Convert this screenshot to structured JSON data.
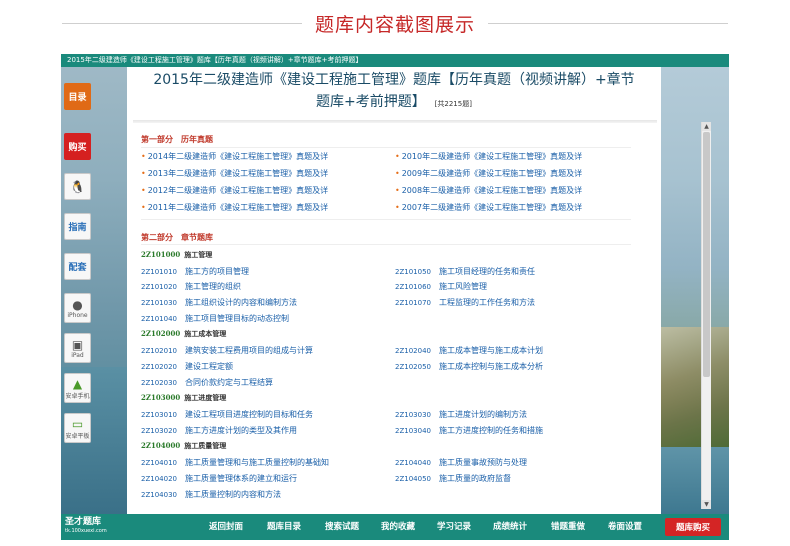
{
  "heading": "题库内容截图展示",
  "window_title": "2015年二级建造师《建设工程施工管理》题库【历年真题（视频讲解）+章节题库+考前押题】",
  "book_title_line1": "2015年二级建造师《建设工程施工管理》题库【历年真题（视频讲解）+章节",
  "book_title_line2": "题库+考前押题】",
  "question_count": "[共2215题]",
  "sidebar": {
    "catalog": "目录",
    "buy": "购买",
    "guide": "指南",
    "config": "配套",
    "iphone": "iPhone",
    "ipad": "iPad",
    "android_phone": "安卓手机",
    "android_tablet": "安卓平板"
  },
  "part1": {
    "title": "第一部分　历年真题",
    "left": [
      "2014年二级建造师《建设工程施工管理》真题及详",
      "2013年二级建造师《建设工程施工管理》真题及详",
      "2012年二级建造师《建设工程施工管理》真题及详",
      "2011年二级建造师《建设工程施工管理》真题及详"
    ],
    "right": [
      "2010年二级建造师《建设工程施工管理》真题及详",
      "2009年二级建造师《建设工程施工管理》真题及详",
      "2008年二级建造师《建设工程施工管理》真题及详",
      "2007年二级建造师《建设工程施工管理》真题及详"
    ]
  },
  "part2": {
    "title": "第二部分　章节题库",
    "chapters": [
      {
        "code": "2Z101000",
        "name": "施工管理"
      },
      {
        "code": "2Z102000",
        "name": "施工成本管理"
      },
      {
        "code": "2Z103000",
        "name": "施工进度管理"
      },
      {
        "code": "2Z104000",
        "name": "施工质量管理"
      }
    ],
    "sections": [
      {
        "code": "2Z101010",
        "name": "施工方的项目管理"
      },
      {
        "code": "2Z101020",
        "name": "施工管理的组织"
      },
      {
        "code": "2Z101030",
        "name": "施工组织设计的内容和编制方法"
      },
      {
        "code": "2Z101040",
        "name": "施工项目管理目标的动态控制"
      },
      {
        "code": "2Z101050",
        "name": "施工项目经理的任务和责任"
      },
      {
        "code": "2Z101060",
        "name": "施工风险管理"
      },
      {
        "code": "2Z101070",
        "name": "工程监理的工作任务和方法"
      },
      {
        "code": "2Z102010",
        "name": "建筑安装工程费用项目的组成与计算"
      },
      {
        "code": "2Z102020",
        "name": "建设工程定额"
      },
      {
        "code": "2Z102030",
        "name": "合同价款约定与工程结算"
      },
      {
        "code": "2Z102040",
        "name": "施工成本管理与施工成本计划"
      },
      {
        "code": "2Z102050",
        "name": "施工成本控制与施工成本分析"
      },
      {
        "code": "2Z103010",
        "name": "建设工程项目进度控制的目标和任务"
      },
      {
        "code": "2Z103020",
        "name": "施工方进度计划的类型及其作用"
      },
      {
        "code": "2Z103030",
        "name": "施工进度计划的编制方法"
      },
      {
        "code": "2Z103040",
        "name": "施工方进度控制的任务和措施"
      },
      {
        "code": "2Z104010",
        "name": "施工质量管理和与施工质量控制的基础知"
      },
      {
        "code": "2Z104020",
        "name": "施工质量管理体系的建立和运行"
      },
      {
        "code": "2Z104030",
        "name": "施工质量控制的内容和方法"
      },
      {
        "code": "2Z104040",
        "name": "施工质量事故预防与处理"
      },
      {
        "code": "2Z104050",
        "name": "施工质量的政府监督"
      }
    ]
  },
  "bottom": {
    "logo": "圣才题库",
    "logo_sub": "tk.100xuexi.com",
    "nav": [
      "返回封面",
      "题库目录",
      "搜索试题",
      "我的收藏",
      "学习记录",
      "成绩统计",
      "错题重做",
      "卷面设置"
    ],
    "buy": "题库购买"
  },
  "colors": {
    "teal_bar": "#1a8a7c",
    "heading_red": "#c62828",
    "link_blue": "#1a5fa8"
  }
}
